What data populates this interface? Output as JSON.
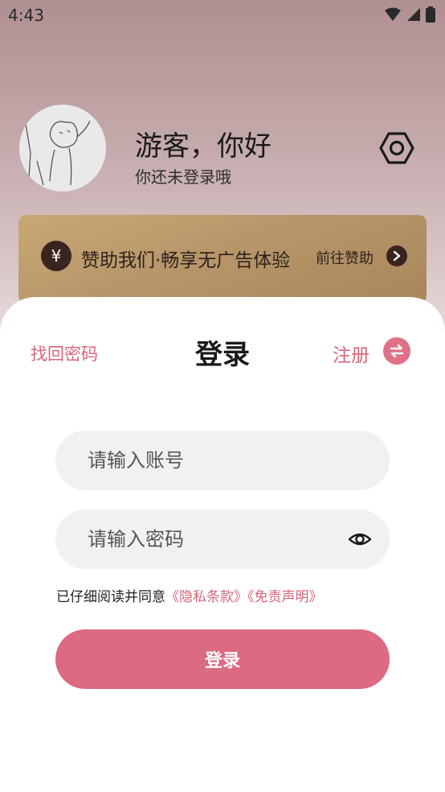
{
  "status_bar": {
    "time": "4:43"
  },
  "profile": {
    "greeting": "游客，你好",
    "subtitle": "你还未登录哦"
  },
  "sponsor": {
    "currency_symbol": "¥",
    "text": "赞助我们·畅享无广告体验",
    "link_label": "前往赞助"
  },
  "login_sheet": {
    "retrieve_password": "找回密码",
    "title": "登录",
    "register": "注册",
    "account": {
      "value": "",
      "placeholder": "请输入账号"
    },
    "password": {
      "value": "",
      "placeholder": "请输入密码"
    },
    "agreement": {
      "prefix": "已仔细阅读并同意",
      "privacy": "《隐私条款》",
      "disclaimer": "《免责声明》"
    },
    "submit_label": "登录"
  },
  "colors": {
    "accent": "#dc6a80",
    "link": "#d9667a",
    "sponsor_bg": "#b8966a",
    "dark_brown": "#3a2420"
  }
}
